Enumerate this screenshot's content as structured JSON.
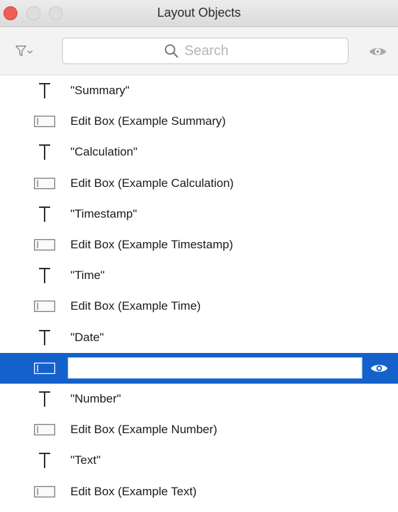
{
  "window": {
    "title": "Layout Objects"
  },
  "toolbar": {
    "filter_icon": "filter-icon",
    "search_placeholder": "Search",
    "search_value": "",
    "visibility_icon": "eye-icon"
  },
  "list": {
    "rows": [
      {
        "type": "text",
        "icon": "text-object-icon",
        "label": "\"Summary\""
      },
      {
        "type": "edit-box",
        "icon": "edit-box-icon",
        "label": "Edit Box (Example Summary)"
      },
      {
        "type": "text",
        "icon": "text-object-icon",
        "label": "\"Calculation\""
      },
      {
        "type": "edit-box",
        "icon": "edit-box-icon",
        "label": "Edit Box (Example Calculation)"
      },
      {
        "type": "text",
        "icon": "text-object-icon",
        "label": "\"Timestamp\""
      },
      {
        "type": "edit-box",
        "icon": "edit-box-icon",
        "label": "Edit Box (Example Timestamp)"
      },
      {
        "type": "text",
        "icon": "text-object-icon",
        "label": "\"Time\""
      },
      {
        "type": "edit-box",
        "icon": "edit-box-icon",
        "label": "Edit Box (Example Time)"
      },
      {
        "type": "text",
        "icon": "text-object-icon",
        "label": "\"Date\""
      },
      {
        "type": "edit-box",
        "icon": "edit-box-icon",
        "label": "",
        "selected": true,
        "editing_value": ""
      },
      {
        "type": "text",
        "icon": "text-object-icon",
        "label": "\"Number\""
      },
      {
        "type": "edit-box",
        "icon": "edit-box-icon",
        "label": "Edit Box (Example Number)"
      },
      {
        "type": "text",
        "icon": "text-object-icon",
        "label": "\"Text\""
      },
      {
        "type": "edit-box",
        "icon": "edit-box-icon",
        "label": "Edit Box (Example Text)"
      }
    ]
  },
  "colors": {
    "selection": "#1461cc",
    "close_button": "#ee5f57"
  }
}
